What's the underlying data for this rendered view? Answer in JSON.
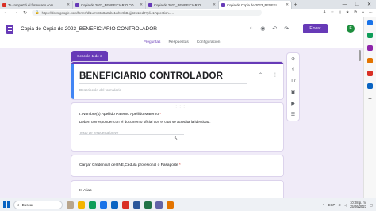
{
  "browser": {
    "tabs": [
      {
        "title": "Te compartió el formulario com…",
        "color": "#d93025",
        "active": false
      },
      {
        "title": "Copia de 2023_BENEFICIARIO CO…",
        "color": "#673ab7",
        "active": false
      },
      {
        "title": "Copia de 2023_BENEFICIARIO…",
        "color": "#673ab7",
        "active": false
      },
      {
        "title": "Copia de Copia de 2023_BENEFI…",
        "color": "#673ab7",
        "active": true
      }
    ],
    "new_tab": "+",
    "window_controls": [
      "—",
      "❐",
      "✕"
    ],
    "url": "https://docs.google.com/forms/d/1uXVs5s8a8abc1whsXbB4jjS2o1/edit?pli=1#question=…"
  },
  "forms": {
    "title": "Copia de Copia de 2023_BENEFICIARIO CONTROLADOR",
    "send_label": "Enviar",
    "avatar_letter": "F",
    "tabs": [
      {
        "label": "Preguntas",
        "active": true
      },
      {
        "label": "Respuestas",
        "active": false
      },
      {
        "label": "Configuración",
        "active": false
      }
    ]
  },
  "section": {
    "label": "Sección 1 de 3",
    "title": "BENEFICIARIO CONTROLADOR",
    "description_placeholder": "Descripción del formulario"
  },
  "questions": [
    {
      "label": "I. Nombre(s) Apellido Paterno Apellido Materno",
      "required": "*",
      "sub": "Deben corresponder con el documento oficial con el cual se acredita la identidad.",
      "placeholder": "Texto de respuesta breve"
    },
    {
      "label": "Cargar Credencial del INE,Cédula profesional o Pasaporte",
      "required": "*"
    },
    {
      "label": "II. Alias"
    }
  ],
  "taskbar": {
    "search_label": "Buscar",
    "language": "ESP",
    "time": "10:08 p. m.",
    "date": "25/06/2023"
  },
  "colors": {
    "accent": "#673ab7",
    "background": "#f0ebf8",
    "required": "#d93025"
  }
}
